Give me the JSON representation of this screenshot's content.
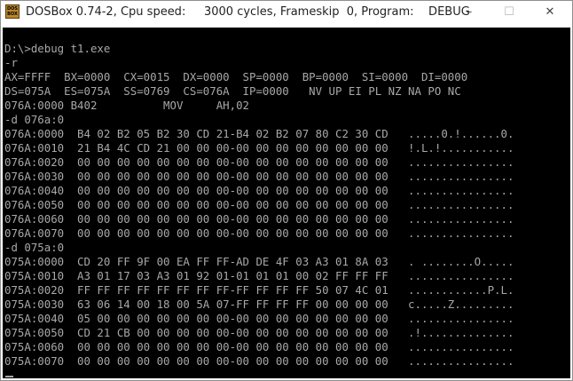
{
  "window": {
    "title": "DOSBox 0.74-2, Cpu speed:     3000 cycles, Frameskip  0, Program:    DEBUG",
    "icon_label": "DOS BOX",
    "controls": {
      "minimize": "–",
      "maximize": "☐",
      "close": "✕"
    }
  },
  "console": {
    "text_color": "#a8a8a8",
    "background": "#000000",
    "lines": [
      "",
      "D:\\>debug t1.exe",
      "-r",
      "AX=FFFF  BX=0000  CX=0015  DX=0000  SP=0000  BP=0000  SI=0000  DI=0000",
      "DS=075A  ES=075A  SS=0769  CS=076A  IP=0000   NV UP EI PL NZ NA PO NC",
      "076A:0000 B402          MOV     AH,02",
      "-d 076a:0",
      "076A:0000  B4 02 B2 05 B2 30 CD 21-B4 02 B2 07 80 C2 30 CD   .....0.!......0.",
      "076A:0010  21 B4 4C CD 21 00 00 00-00 00 00 00 00 00 00 00   !.L.!...........",
      "076A:0020  00 00 00 00 00 00 00 00-00 00 00 00 00 00 00 00   ................",
      "076A:0030  00 00 00 00 00 00 00 00-00 00 00 00 00 00 00 00   ................",
      "076A:0040  00 00 00 00 00 00 00 00-00 00 00 00 00 00 00 00   ................",
      "076A:0050  00 00 00 00 00 00 00 00-00 00 00 00 00 00 00 00   ................",
      "076A:0060  00 00 00 00 00 00 00 00-00 00 00 00 00 00 00 00   ................",
      "076A:0070  00 00 00 00 00 00 00 00-00 00 00 00 00 00 00 00   ................",
      "-d 075a:0",
      "075A:0000  CD 20 FF 9F 00 EA FF FF-AD DE 4F 03 A3 01 8A 03   . ........O.....",
      "075A:0010  A3 01 17 03 A3 01 92 01-01 01 01 00 02 FF FF FF   ................",
      "075A:0020  FF FF FF FF FF FF FF FF-FF FF FF FF 50 07 4C 01   ............P.L.",
      "075A:0030  63 06 14 00 18 00 5A 07-FF FF FF FF 00 00 00 00   c.....Z.........",
      "075A:0040  05 00 00 00 00 00 00 00-00 00 00 00 00 00 00 00   ................",
      "075A:0050  CD 21 CB 00 00 00 00 00-00 00 00 00 00 00 00 00   .!..............",
      "075A:0060  00 00 00 00 00 00 00 00-00 00 00 00 00 00 00 00   ................",
      "075A:0070  00 00 00 00 00 00 00 00-00 00 00 00 00 00 00 00   ................",
      "-"
    ]
  }
}
